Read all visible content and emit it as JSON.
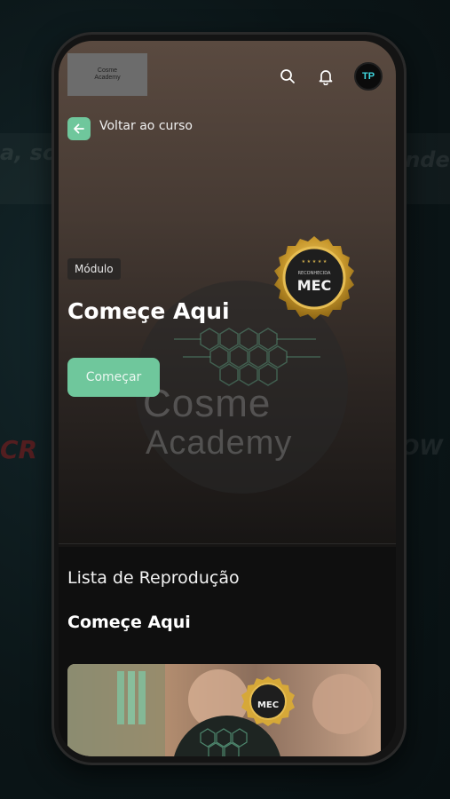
{
  "header": {
    "logo_line1": "Cosme",
    "logo_line2": "Academy",
    "avatar_initials": "TP"
  },
  "nav": {
    "back_label": "Voltar ao curso"
  },
  "hero": {
    "chip": "Módulo",
    "title": "Começe Aqui",
    "start_label": "Começar",
    "watermark_line1": "Cosme",
    "watermark_line2": "Academy"
  },
  "seal": {
    "brand": "MEC",
    "caption": "RECONHECIDA"
  },
  "playlist": {
    "heading": "Lista de Reprodução",
    "module_title": "Começe Aqui",
    "thumb_seal": "MEC"
  },
  "colors": {
    "accent": "#6fc79c",
    "background": "#0f0f0f"
  },
  "icons": [
    "search-icon",
    "bell-icon",
    "arrow-left-icon"
  ]
}
